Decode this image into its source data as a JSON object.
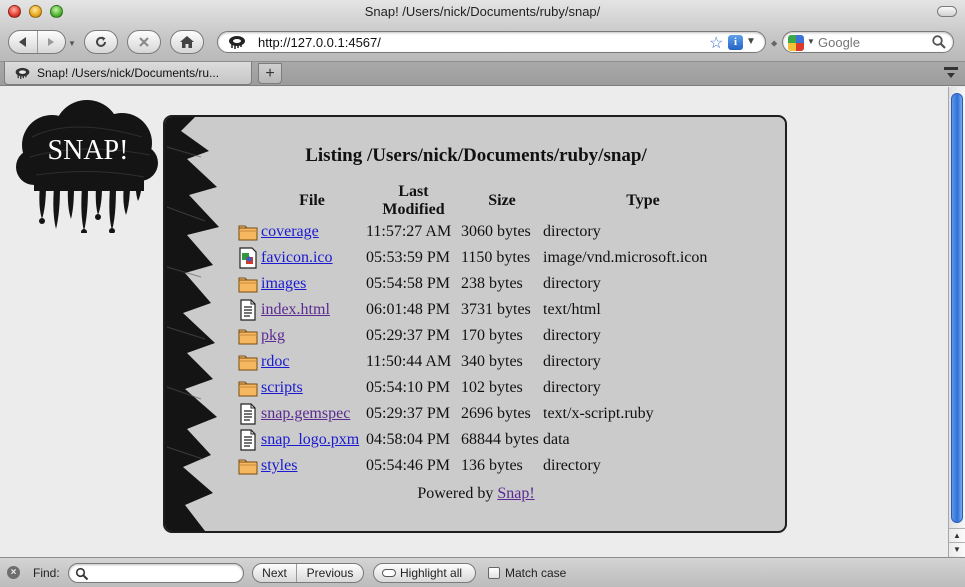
{
  "window": {
    "title": "Snap! /Users/nick/Documents/ruby/snap/"
  },
  "toolbar": {
    "url": "http://127.0.0.1:4567/",
    "search_placeholder": "Google"
  },
  "tabs": [
    {
      "label": "Snap! /Users/nick/Documents/ru...",
      "active": true
    }
  ],
  "page": {
    "logo_text": "SNAP!",
    "heading": "Listing /Users/nick/Documents/ruby/snap/",
    "columns": {
      "file": "File",
      "modified": "Last Modified",
      "size": "Size",
      "type": "Type"
    },
    "files": [
      {
        "name": "coverage",
        "modified": "11:57:27 AM",
        "size": "3060 bytes",
        "type": "directory",
        "icon": "folder-icon",
        "visited": false
      },
      {
        "name": "favicon.ico",
        "modified": "05:53:59 PM",
        "size": "1150 bytes",
        "type": "image/vnd.microsoft.icon",
        "icon": "image-file-icon",
        "visited": false
      },
      {
        "name": "images",
        "modified": "05:54:58 PM",
        "size": "238 bytes",
        "type": "directory",
        "icon": "folder-icon",
        "visited": false
      },
      {
        "name": "index.html",
        "modified": "06:01:48 PM",
        "size": "3731 bytes",
        "type": "text/html",
        "icon": "document-icon",
        "visited": true
      },
      {
        "name": "pkg",
        "modified": "05:29:37 PM",
        "size": "170 bytes",
        "type": "directory",
        "icon": "folder-icon",
        "visited": true
      },
      {
        "name": "rdoc",
        "modified": "11:50:44 AM",
        "size": "340 bytes",
        "type": "directory",
        "icon": "folder-icon",
        "visited": false
      },
      {
        "name": "scripts",
        "modified": "05:54:10 PM",
        "size": "102 bytes",
        "type": "directory",
        "icon": "folder-icon",
        "visited": false
      },
      {
        "name": "snap.gemspec",
        "modified": "05:29:37 PM",
        "size": "2696 bytes",
        "type": "text/x-script.ruby",
        "icon": "document-icon",
        "visited": true
      },
      {
        "name": "snap_logo.pxm",
        "modified": "04:58:04 PM",
        "size": "68844 bytes",
        "type": "data",
        "icon": "document-icon",
        "visited": false
      },
      {
        "name": "styles",
        "modified": "05:54:46 PM",
        "size": "136 bytes",
        "type": "directory",
        "icon": "folder-icon",
        "visited": false
      }
    ],
    "powered_by": "Powered by",
    "powered_link": "Snap!"
  },
  "findbar": {
    "label": "Find:",
    "value": "",
    "next": "Next",
    "previous": "Previous",
    "highlight_all": "Highlight all",
    "match_case": "Match case",
    "match_case_checked": false
  },
  "colors": {
    "link": "#1a1ad0",
    "visited_link": "#5a2a90",
    "panel_background": "#cbcbcb",
    "scroll_thumb": "#2f6fd8"
  }
}
